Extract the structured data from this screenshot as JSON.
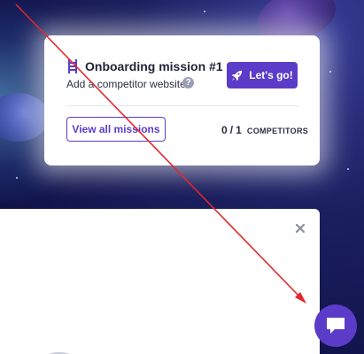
{
  "mission": {
    "title": "Onboarding mission #1",
    "subtitle": "Add a competitor website",
    "help_glyph": "?",
    "start_label": "Let's go!",
    "view_all_label": "View all missions",
    "progress_done": "0",
    "progress_separator": "/",
    "progress_total": "1",
    "progress_unit": "COMPETITORS"
  },
  "icons": {
    "mission": "ladder-icon",
    "help": "help-icon",
    "rocket": "rocket-icon",
    "close": "close-icon",
    "chat": "chat-bubble-icon"
  },
  "colors": {
    "accent": "#5b3cc9",
    "background": "#11134a",
    "annotation": "#e3262b"
  }
}
